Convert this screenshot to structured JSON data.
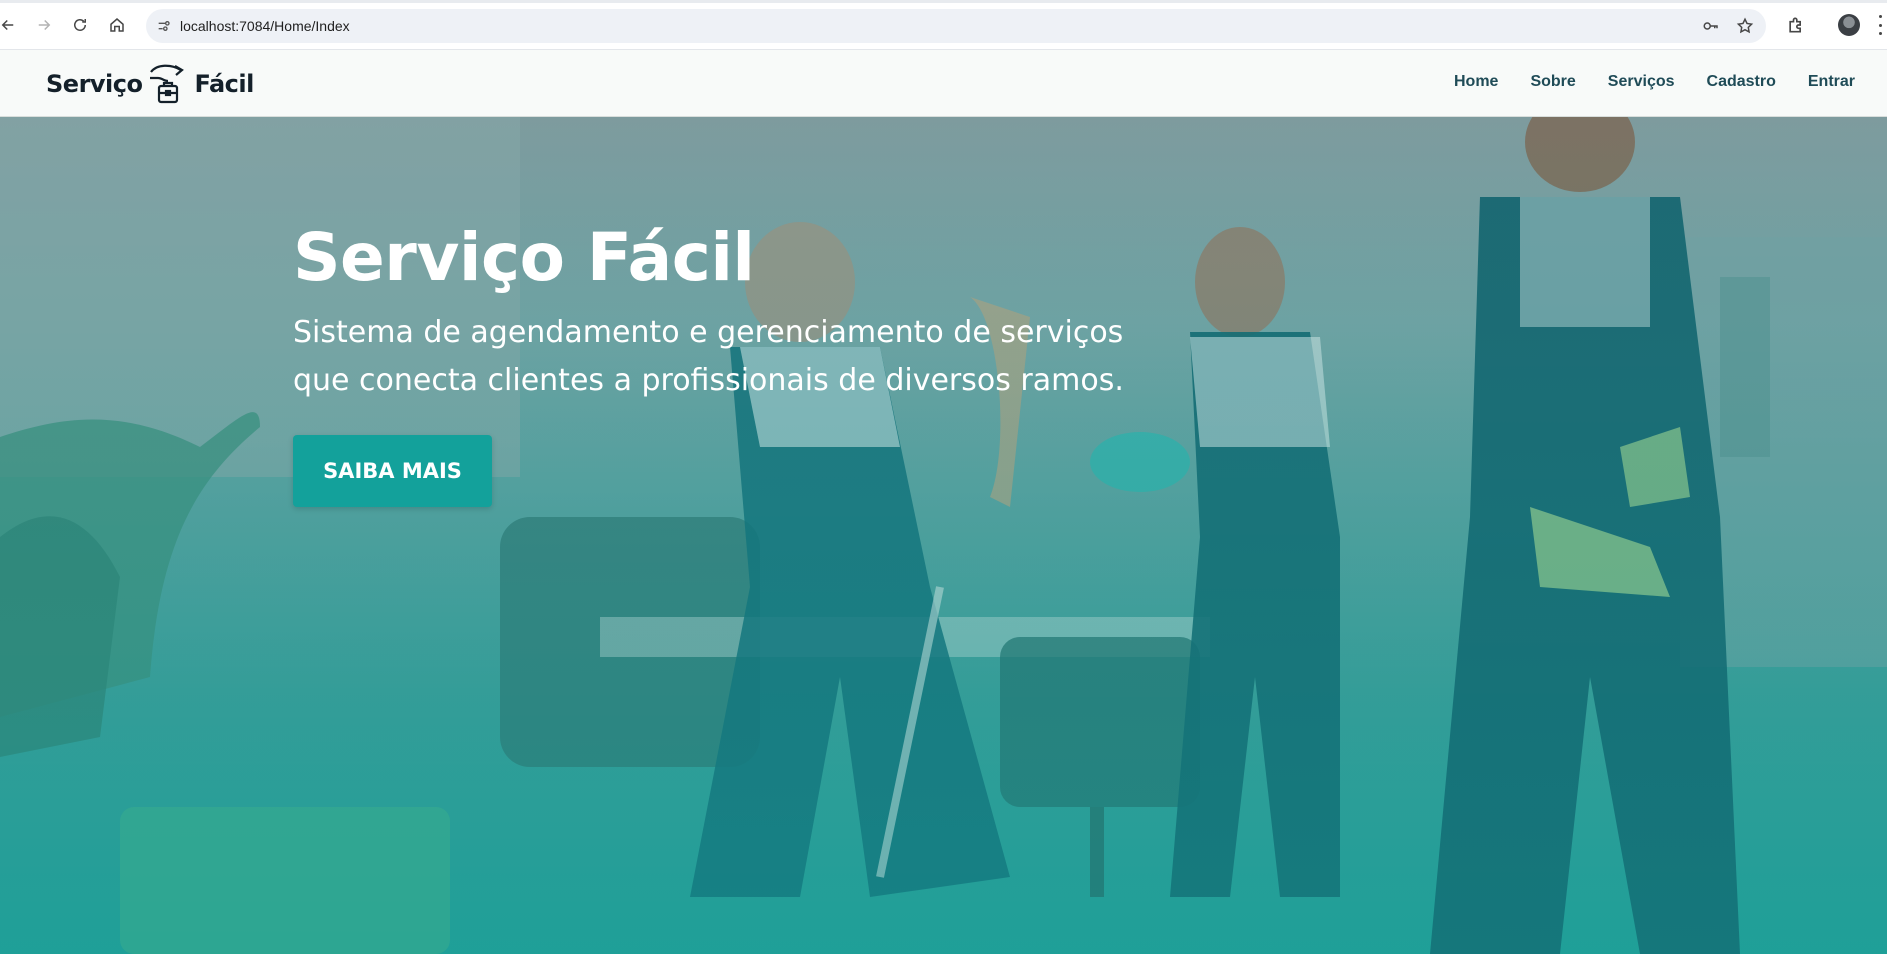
{
  "browser": {
    "url": "localhost:7084/Home/Index"
  },
  "header": {
    "brand_left": "Serviço",
    "brand_right": "Fácil",
    "nav": [
      {
        "label": "Home"
      },
      {
        "label": "Sobre"
      },
      {
        "label": "Serviços"
      },
      {
        "label": "Cadastro"
      },
      {
        "label": "Entrar"
      }
    ]
  },
  "hero": {
    "title": "Serviço Fácil",
    "subtitle": "Sistema de agendamento e gerenciamento de serviços que conecta clientes a profissionais de diversos ramos.",
    "cta_label": "SAIBA MAIS"
  },
  "colors": {
    "accent": "#13a19b",
    "nav_text": "#1f4b57",
    "brand_text": "#14202a"
  },
  "icons": [
    "back-icon",
    "forward-icon",
    "reload-icon",
    "home-icon",
    "site-info-icon",
    "password-key-icon",
    "bookmark-star-icon",
    "extensions-icon",
    "profile-avatar",
    "menu-icon",
    "brand-logo-icon"
  ]
}
